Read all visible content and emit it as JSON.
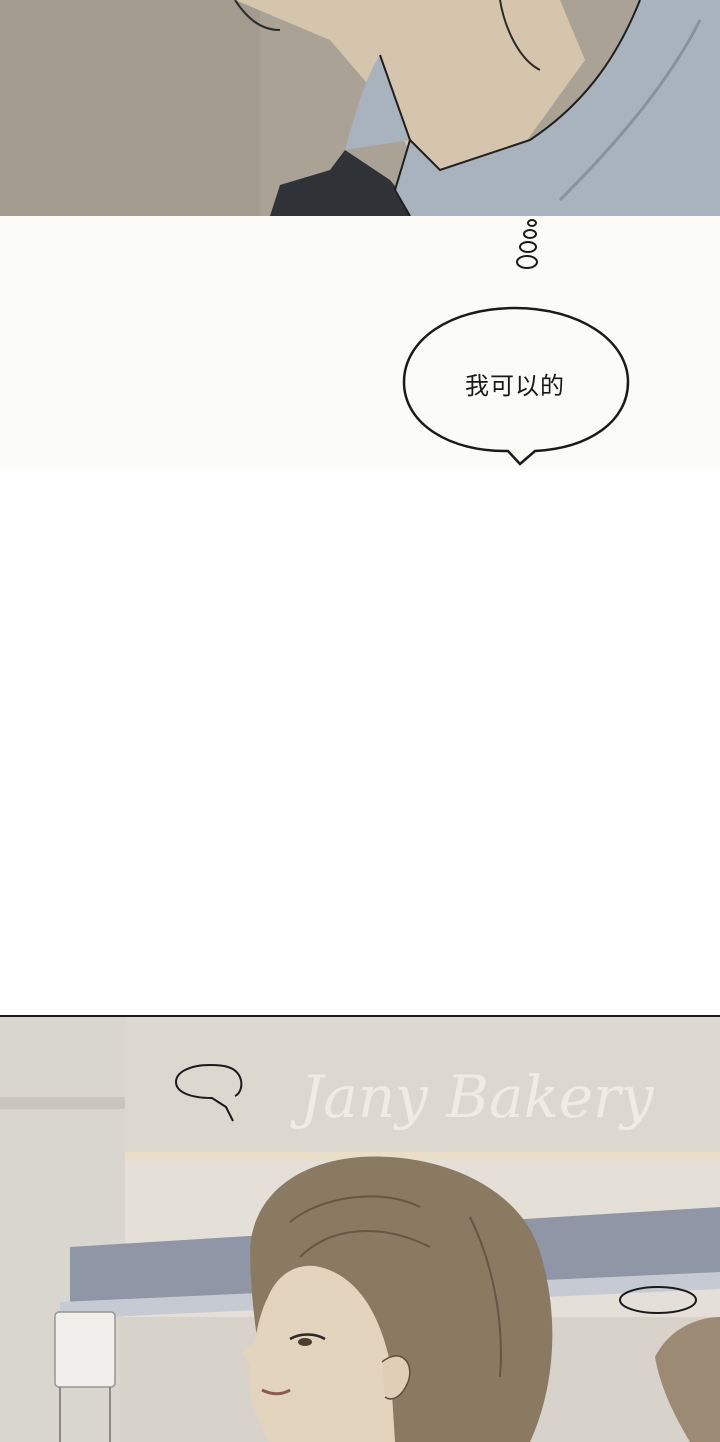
{
  "panels": {
    "bubble": {
      "speech_text": "我可以的"
    },
    "bottom": {
      "shop_sign_text": "Jany Bakery"
    }
  },
  "colors": {
    "shirt": "#a8b3be",
    "background_warm": "#b3ab9d",
    "page": "#ffffff",
    "hair": "#8a7a62"
  }
}
